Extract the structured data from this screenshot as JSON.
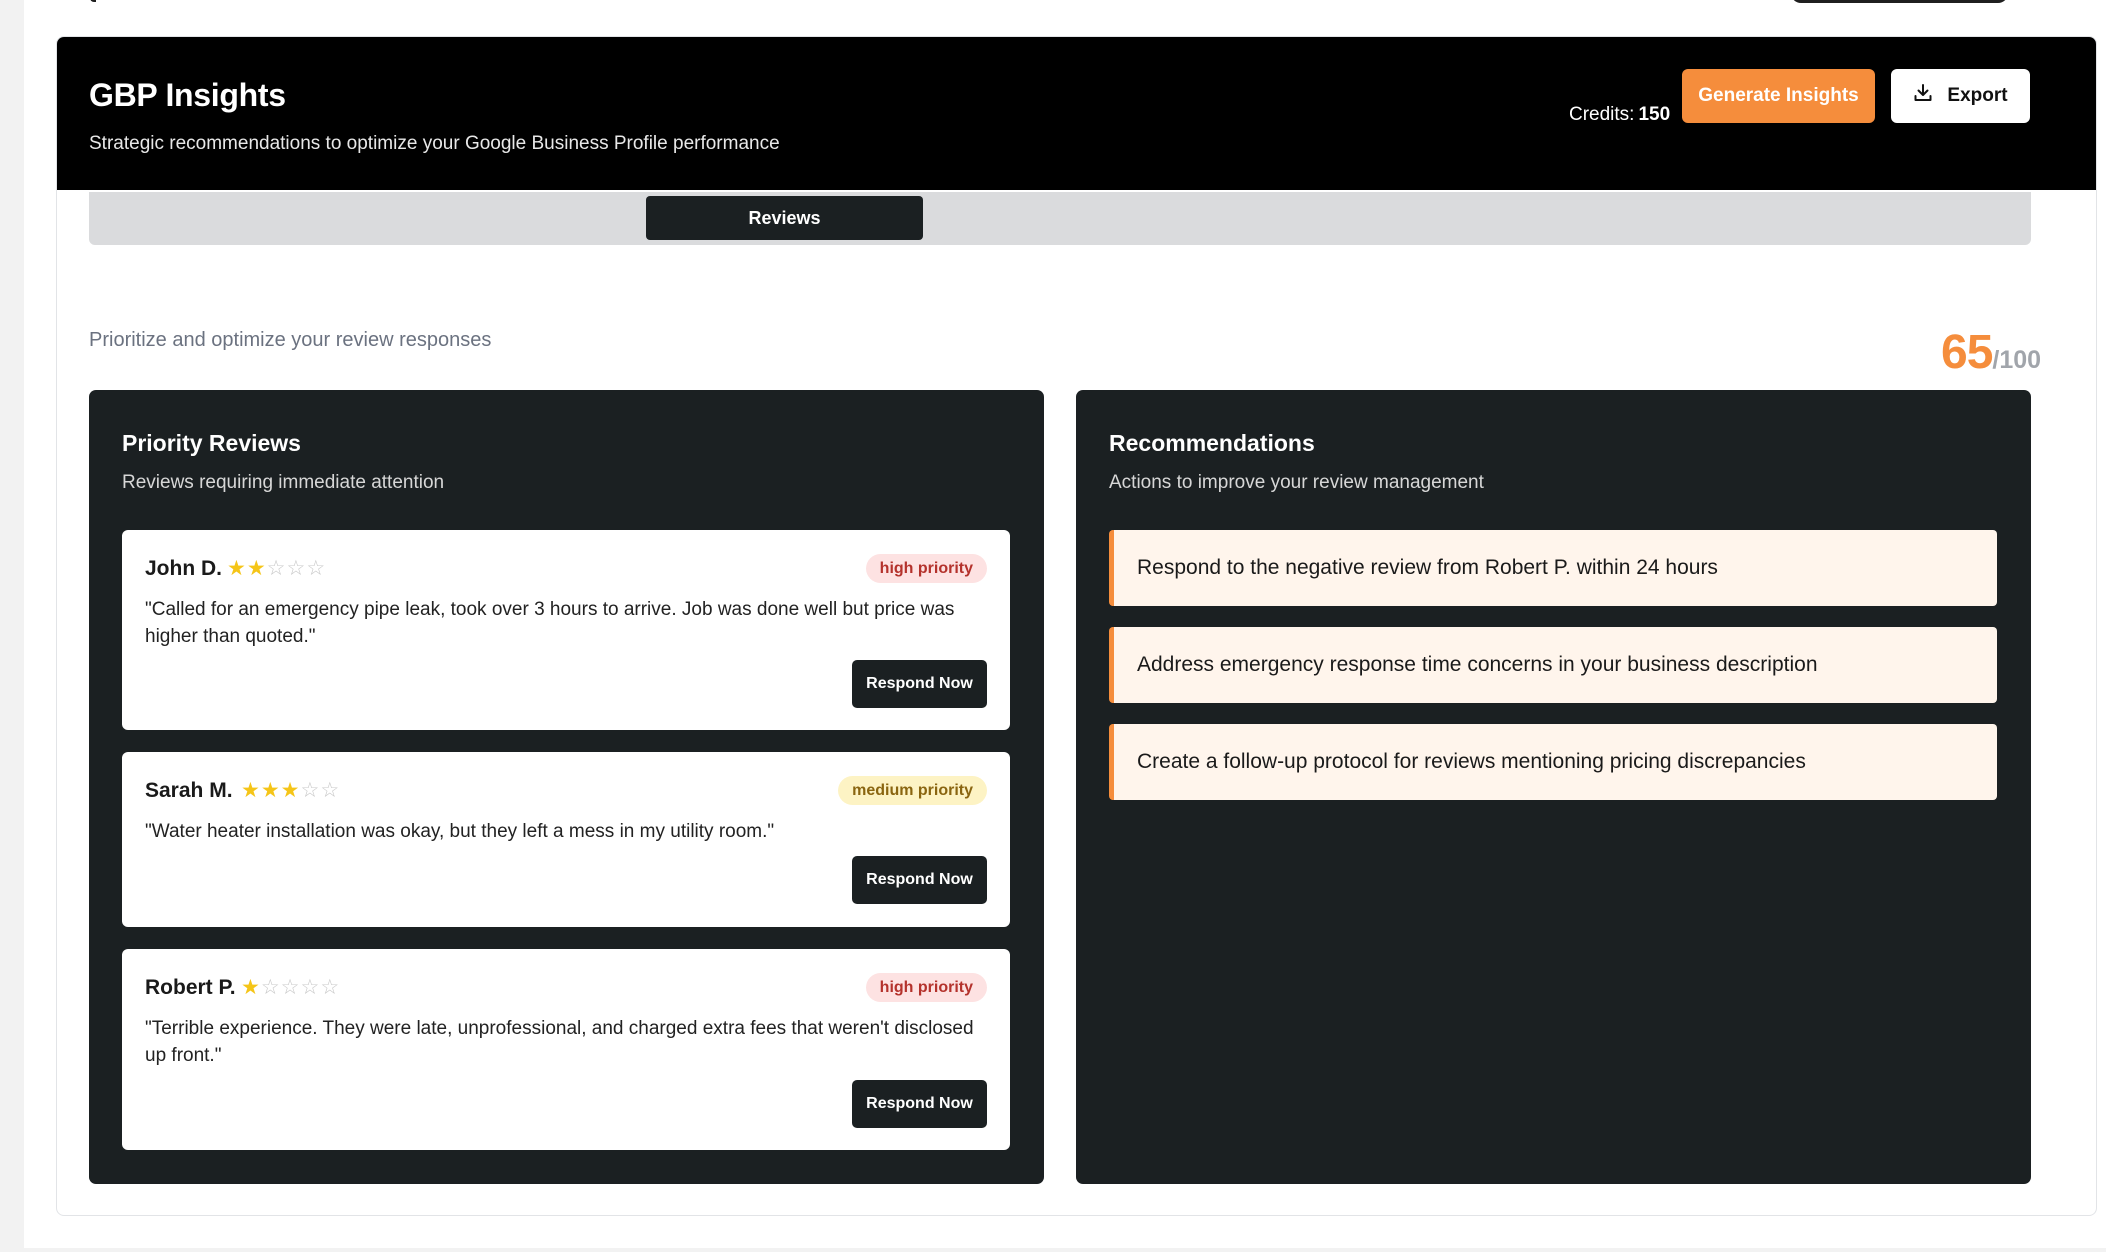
{
  "header": {
    "title": "GBP Insights",
    "subtitle": "Strategic recommendations to optimize your Google Business Profile performance",
    "credits_label": "Credits:",
    "credits_value": "150",
    "generate_label": "Generate Insights",
    "export_label": "Export",
    "export_icon": "download-icon"
  },
  "tabs": {
    "active_label": "Reviews"
  },
  "section": {
    "description": "Prioritize and optimize your review responses",
    "score_value": "65",
    "score_max": "/100"
  },
  "priority_reviews": {
    "title": "Priority Reviews",
    "subtitle": "Reviews requiring immediate attention",
    "respond_label": "Respond Now",
    "items": [
      {
        "name": "John D.",
        "rating": 2,
        "max_rating": 5,
        "priority": "high priority",
        "text": "\"Called for an emergency pipe leak, took over 3 hours to arrive. Job was done well but price was higher than quoted.\""
      },
      {
        "name": "Sarah M.",
        "rating": 3,
        "max_rating": 5,
        "priority": "medium priority",
        "text": "\"Water heater installation was okay, but they left a mess in my utility room.\""
      },
      {
        "name": "Robert P.",
        "rating": 1,
        "max_rating": 5,
        "priority": "high priority",
        "text": "\"Terrible experience. They were late, unprofessional, and charged extra fees that weren't disclosed up front.\""
      }
    ]
  },
  "recommendations": {
    "title": "Recommendations",
    "subtitle": "Actions to improve your review management",
    "items": [
      "Respond to the negative review from Robert P. within 24 hours",
      "Address emergency response time concerns in your business description",
      "Create a follow-up protocol for reviews mentioning pricing discrepancies"
    ]
  },
  "colors": {
    "accent": "#f58d3c",
    "panel_bg": "#1b2022",
    "header_bg": "#000000",
    "star": "#f5c518",
    "high_priority_bg": "#fde2e2",
    "medium_priority_bg": "#fdf3c4"
  }
}
